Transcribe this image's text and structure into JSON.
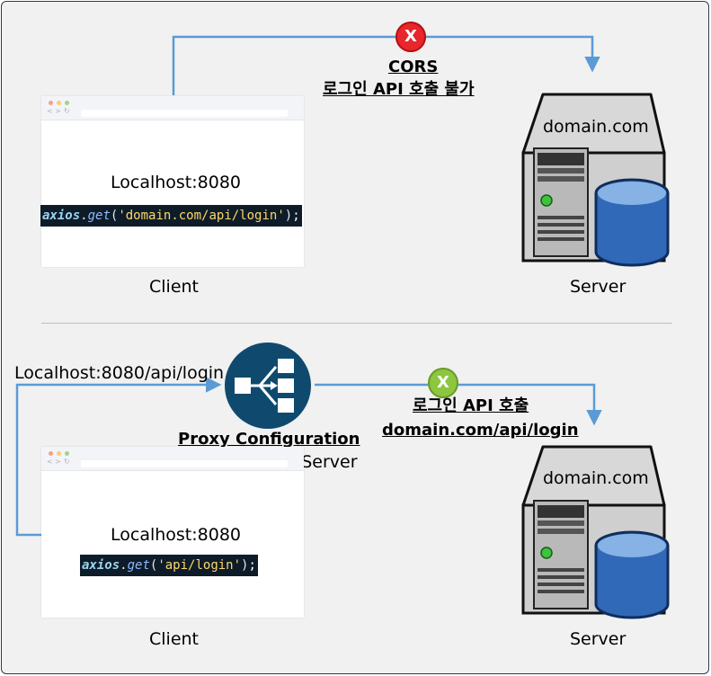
{
  "top": {
    "client": {
      "host_label": "Localhost:8080",
      "caption": "Client"
    },
    "code": {
      "obj": "axios",
      "dot": ".",
      "fn": "get",
      "open": "(",
      "arg": "'domain.com/api/login'",
      "close": ")",
      "semi": ";"
    },
    "status": {
      "icon": "x-error-icon",
      "color": "#e8262b",
      "glyph": "X",
      "line1": "CORS",
      "line2": "로그인 API 호출 불가"
    },
    "server": {
      "domain": "domain.com",
      "caption": "Server"
    }
  },
  "bottom": {
    "request_url": "Localhost:8080/api/login",
    "proxy": {
      "icon": "network-share-icon",
      "title": "Proxy Configuration",
      "subtitle": "Webpack Dev Server"
    },
    "client": {
      "host_label": "Localhost:8080",
      "caption": "Client"
    },
    "code": {
      "obj": "axios",
      "dot": ".",
      "fn": "get",
      "open": "(",
      "arg": "'api/login'",
      "close": ")",
      "semi": ";"
    },
    "status": {
      "icon": "x-success-icon",
      "color": "#8dc63f",
      "glyph": "X",
      "line1": "로그인 API 호출",
      "line2": "domain.com/api/login"
    },
    "server": {
      "domain": "domain.com",
      "caption": "Server"
    }
  },
  "colors": {
    "wire": "#5b9bd5",
    "proxy_circle": "#0f4a6e",
    "frame": "#2f3b4c"
  }
}
